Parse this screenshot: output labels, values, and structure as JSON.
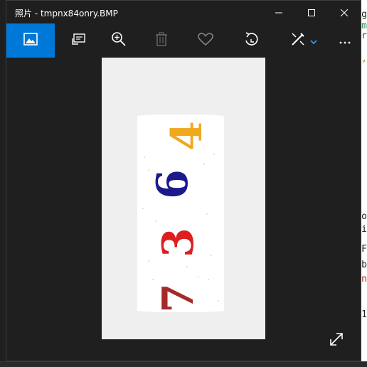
{
  "window": {
    "title": "照片 - tmpnx84onry.BMP"
  },
  "titlebar": {
    "minimize_icon": "minimize-icon",
    "maximize_icon": "maximize-icon",
    "close_icon": "close-icon"
  },
  "toolbar": {
    "items": [
      {
        "name": "collection",
        "icon": "image-icon",
        "active": true
      },
      {
        "name": "slideshow",
        "icon": "slideshow-icon"
      },
      {
        "name": "zoom",
        "icon": "zoom-in-icon"
      },
      {
        "name": "delete",
        "icon": "trash-icon",
        "disabled": true
      },
      {
        "name": "favorite",
        "icon": "heart-icon"
      },
      {
        "name": "rotate",
        "icon": "rotate-icon"
      },
      {
        "name": "edit",
        "icon": "edit-icon",
        "has_dropdown": true
      },
      {
        "name": "more",
        "icon": "more-icon"
      }
    ],
    "accent_color": "#0078d7"
  },
  "image": {
    "captcha_digits": [
      "7",
      "3",
      "6",
      "4"
    ],
    "digit_colors": [
      "#a52a2a",
      "#dd1f1f",
      "#1a1a8c",
      "#f0a81c"
    ]
  },
  "viewer": {
    "expand_icon": "expand-icon"
  }
}
